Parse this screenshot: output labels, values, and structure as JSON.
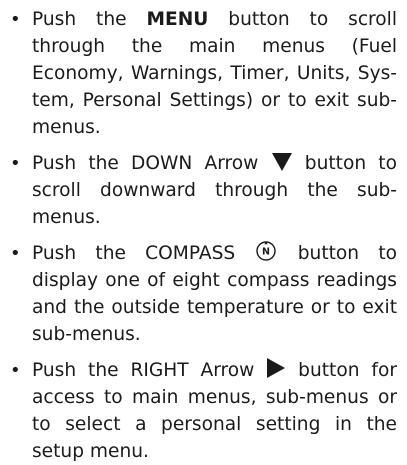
{
  "instructions": [
    {
      "before": "Push the ",
      "key": "MENU",
      "after": " button to scroll through the main menus (Fuel Economy, Warnings, Timer, Units, Sys-tem, Personal Settings) or to exit sub-menus."
    },
    {
      "before": "Push the DOWN Arrow",
      "icon": "down-triangle-icon",
      "after": " button to scroll downward through the sub-menus."
    },
    {
      "before": "Push the COMPASS ",
      "icon": "compass-icon",
      "icon_letter": "N",
      "after": " button to display one of eight compass readings and the outside temperature or to exit sub-menus."
    },
    {
      "before": "Push the RIGHT Arrow",
      "icon": "right-triangle-icon",
      "after": " button for access to main menus, sub-menus or to select a personal setting in the setup menu."
    }
  ]
}
